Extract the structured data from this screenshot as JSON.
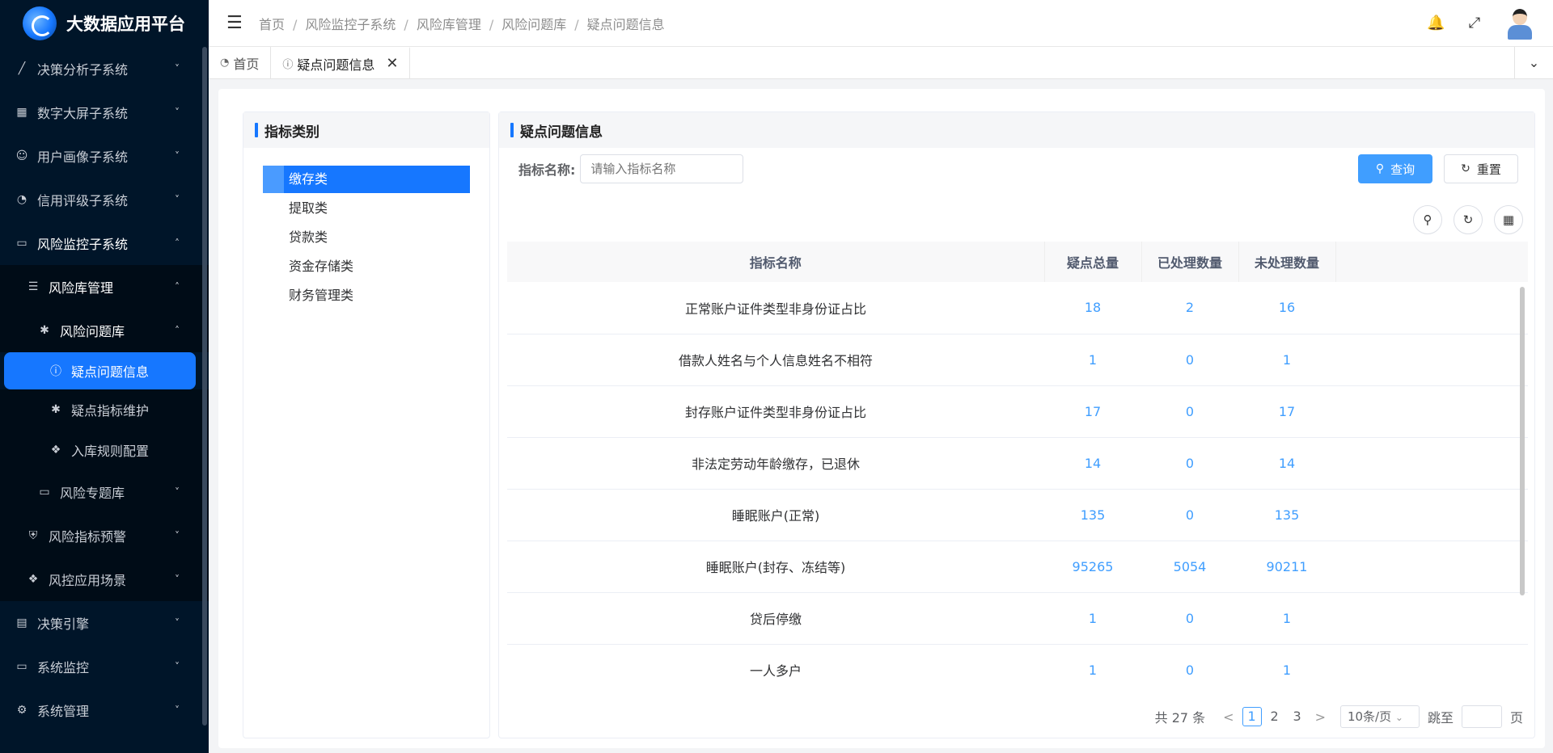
{
  "app": {
    "title": "大数据应用平台",
    "accent": "#1677ff"
  },
  "sidebar": {
    "items": [
      {
        "label": "决策分析子系统",
        "icon": "chart-icon",
        "level": 1,
        "state": "collapsed"
      },
      {
        "label": "数字大屏子系统",
        "icon": "grid-icon",
        "level": 1,
        "state": "collapsed"
      },
      {
        "label": "用户画像子系统",
        "icon": "user-icon",
        "level": 1,
        "state": "collapsed"
      },
      {
        "label": "信用评级子系统",
        "icon": "gauge-icon",
        "level": 1,
        "state": "collapsed"
      },
      {
        "label": "风险监控子系统",
        "icon": "monitor-icon",
        "level": 1,
        "state": "expanded"
      },
      {
        "label": "风险库管理",
        "icon": "layers-icon",
        "level": 2,
        "state": "expanded"
      },
      {
        "label": "风险问题库",
        "icon": "bug-icon",
        "level": 3,
        "state": "expanded"
      },
      {
        "label": "疑点问题信息",
        "icon": "question-icon",
        "level": 4,
        "state": "active"
      },
      {
        "label": "疑点指标维护",
        "icon": "bug-icon",
        "level": 4,
        "state": "leaf"
      },
      {
        "label": "入库规则配置",
        "icon": "puzzle-icon",
        "level": 4,
        "state": "leaf"
      },
      {
        "label": "风险专题库",
        "icon": "monitor-icon",
        "level": 3,
        "state": "collapsed"
      },
      {
        "label": "风险指标预警",
        "icon": "shield-icon",
        "level": 2,
        "state": "collapsed"
      },
      {
        "label": "风控应用场景",
        "icon": "apps-icon",
        "level": 2,
        "state": "collapsed"
      },
      {
        "label": "决策引擎",
        "icon": "document-icon",
        "level": 1,
        "state": "collapsed"
      },
      {
        "label": "系统监控",
        "icon": "monitor-icon",
        "level": 1,
        "state": "collapsed"
      },
      {
        "label": "系统管理",
        "icon": "gear-icon",
        "level": 1,
        "state": "collapsed"
      }
    ]
  },
  "breadcrumb": [
    "首页",
    "风险监控子系统",
    "风险库管理",
    "风险问题库",
    "疑点问题信息"
  ],
  "tabs": [
    {
      "label": "首页",
      "icon": "dashboard-icon"
    },
    {
      "label": "疑点问题信息",
      "icon": "question-icon"
    }
  ],
  "left_panel": {
    "title": "指标类别",
    "categories": [
      "缴存类",
      "提取类",
      "贷款类",
      "资金存储类",
      "财务管理类"
    ],
    "selected_index": 0
  },
  "right_panel": {
    "title": "疑点问题信息",
    "search": {
      "label": "指标名称:",
      "placeholder": "请输入指标名称"
    },
    "query_label": "查询",
    "reset_label": "重置",
    "columns": [
      "指标名称",
      "疑点总量",
      "已处理数量",
      "未处理数量"
    ],
    "rows": [
      [
        "正常账户证件类型非身份证占比",
        "18",
        "2",
        "16"
      ],
      [
        "借款人姓名与个人信息姓名不相符",
        "1",
        "0",
        "1"
      ],
      [
        "封存账户证件类型非身份证占比",
        "17",
        "0",
        "17"
      ],
      [
        "非法定劳动年龄缴存，已退休",
        "14",
        "0",
        "14"
      ],
      [
        "睡眠账户(正常)",
        "135",
        "0",
        "135"
      ],
      [
        "睡眠账户(封存、冻结等)",
        "95265",
        "5054",
        "90211"
      ],
      [
        "贷后停缴",
        "1",
        "0",
        "1"
      ],
      [
        "一人多户",
        "1",
        "0",
        "1"
      ]
    ],
    "pagination": {
      "total_text": "共 27 条",
      "pages": [
        "1",
        "2",
        "3"
      ],
      "current": "1",
      "page_size": "10条/页",
      "jump_prefix": "跳至",
      "jump_suffix": "页"
    }
  }
}
